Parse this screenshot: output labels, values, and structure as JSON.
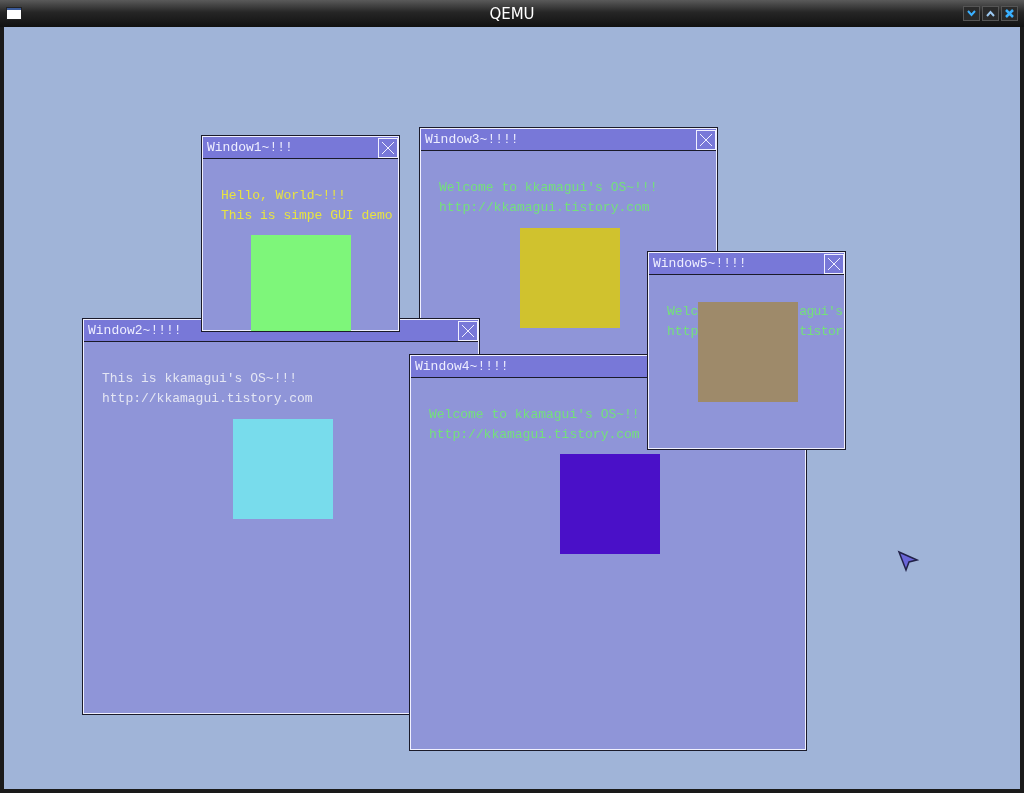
{
  "window": {
    "title": "QEMU"
  },
  "desktop": {
    "windows": [
      {
        "title": "Window3~!!!!",
        "close": true,
        "lines": [
          {
            "texts": [
              "Welcome to kkamagui's OS~!!!"
            ],
            "color": "#74e07c"
          },
          {
            "texts": [
              "http://kkamagui.tistory.com"
            ],
            "color": "#74e07c"
          }
        ],
        "color": "#d0c22e"
      },
      {
        "title": "Window2~!!!!",
        "close": true,
        "lines": [
          {
            "texts": [
              "This is kkamagui's OS~!!!"
            ],
            "color": "#e4e6f4"
          },
          {
            "texts": [
              "http://kkamagui.tistory.com"
            ],
            "color": "#e4e6f4"
          }
        ],
        "color": "#78dcec"
      },
      {
        "title": "Window1~!!!",
        "close": true,
        "lines": [
          {
            "texts": [
              "Hello, World~!!!"
            ],
            "color": "#e8e440"
          },
          {
            "texts": [
              "This is simpe GUI demo"
            ],
            "color": "#e8e440"
          }
        ],
        "color": "#7ef67a"
      },
      {
        "title": "Window4~!!!!",
        "close": false,
        "lines": [
          {
            "texts": [
              "Welcome to kkamagui's OS~!!"
            ],
            "color": "#74e07c"
          },
          {
            "texts": [
              "http://kkamagui.tistory.com"
            ],
            "color": "#74e07c"
          }
        ],
        "color": "#4a10c8"
      },
      {
        "title": "Window5~!!!!",
        "close": true,
        "lines": [
          {
            "texts": [
              "Welc",
              "agui's"
            ],
            "color": "#74e07c"
          },
          {
            "texts": [
              "http",
              "tistor"
            ],
            "color": "#74e07c"
          }
        ],
        "color": "#9e8a6a"
      }
    ]
  }
}
